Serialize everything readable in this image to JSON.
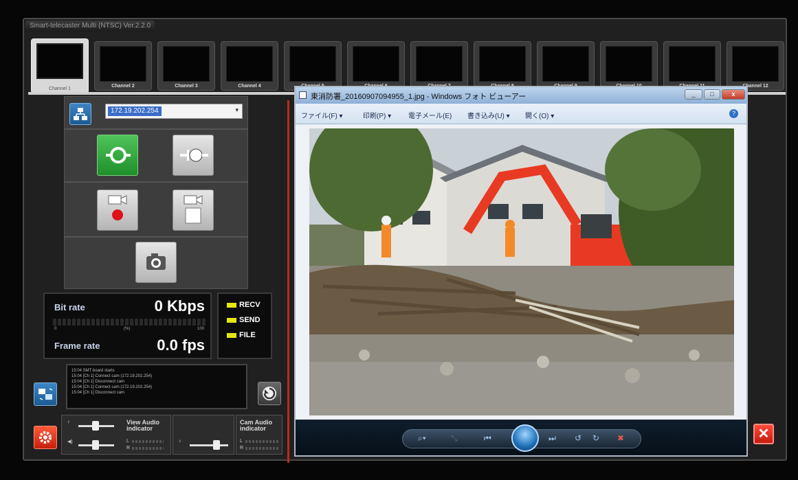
{
  "app": {
    "title": "Smart-telecaster Multi (NTSC) Ver.2.2.0"
  },
  "channels": [
    "Channel 1",
    "Channel 2",
    "Channel 3",
    "Channel 4",
    "Channel 5",
    "Channel 6",
    "Channel 7",
    "Channel 8",
    "Channel 9",
    "Channel 10",
    "Channel 11",
    "Channel 12"
  ],
  "active_channel": "Channel 1",
  "connection": {
    "ip_value": "172.19.202.254"
  },
  "stats": {
    "bitrate_label": "Bit rate",
    "bitrate_value": "0 Kbps",
    "framerate_label": "Frame rate",
    "framerate_value": "0.0 fps",
    "meter_min": "0",
    "meter_mid": "(%)",
    "meter_max": "100",
    "meter_level": 0
  },
  "indicators": [
    "RECV",
    "SEND",
    "FILE"
  ],
  "log": [
    "15:04 SMT board starts",
    "15:04 [Ch 1] Connect cam (172.19.202.254)",
    "15:04 [Ch 1] Disconnect cam",
    "15:04 [Ch 1] Connect cam (172.19.202.254)",
    "15:04 [Ch 1] Disconnect cam"
  ],
  "audio": {
    "view_label": "View Audio indicator",
    "cam_label": "Cam Audio indicator",
    "left": "L",
    "right": "R"
  },
  "viewer": {
    "title": "東消防署_20160907094955_1.jpg - Windows フォト ビューアー",
    "menu": [
      "ファイル(F) ▾",
      "印刷(P) ▾",
      "電子メール(E)",
      "書き込み(U) ▾",
      "開く(O) ▾"
    ],
    "help": "?"
  },
  "colors": {
    "accent_green": "#1f8f2a",
    "accent_red": "#c6200c",
    "indicator_yellow": "#e6e612",
    "ip_highlight": "#3a6dc9"
  }
}
